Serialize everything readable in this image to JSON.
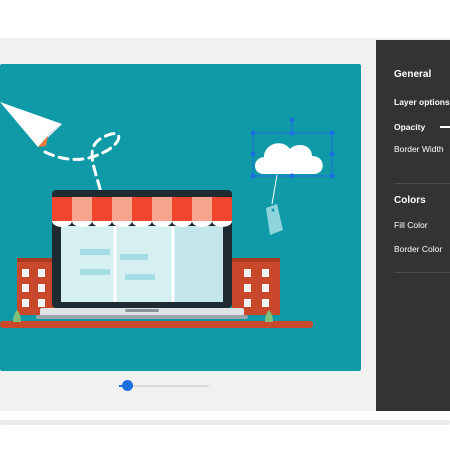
{
  "panel": {
    "general_title": "General",
    "layer_options": "Layer options",
    "opacity": "Opacity",
    "border_width": "Border Width",
    "colors_title": "Colors",
    "fill_color": "Fill Color",
    "border_color": "Border Color"
  },
  "canvas": {
    "background_color": "#109aa7",
    "illustration": "online-store-laptop-illustration"
  },
  "zoom_slider": {
    "value": 0.05
  },
  "colors": {
    "panel_bg": "#333333",
    "accent": "#1b6fe0",
    "awning_red": "#f0462d",
    "building_brick": "#c9472b"
  }
}
